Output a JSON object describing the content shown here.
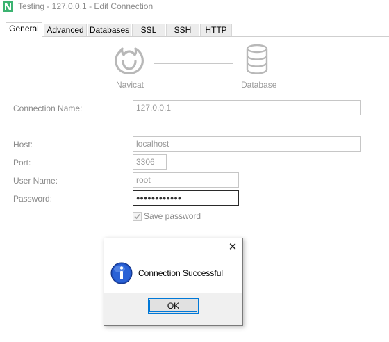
{
  "window": {
    "title": "Testing - 127.0.0.1 - Edit Connection",
    "app_icon": "navicat-app-icon",
    "accent_color": "#3cb371"
  },
  "tabs": [
    {
      "label": "General",
      "active": true
    },
    {
      "label": "Advanced",
      "active": false
    },
    {
      "label": "Databases",
      "active": false
    },
    {
      "label": "SSL",
      "active": false
    },
    {
      "label": "SSH",
      "active": false
    },
    {
      "label": "HTTP",
      "active": false
    }
  ],
  "diagram": {
    "left_icon": "navicat-logo-icon",
    "left_label": "Navicat",
    "right_icon": "database-icon",
    "right_label": "Database"
  },
  "form": {
    "connection_name_label": "Connection Name:",
    "connection_name_value": "127.0.0.1",
    "host_label": "Host:",
    "host_value": "localhost",
    "port_label": "Port:",
    "port_value": "3306",
    "username_label": "User Name:",
    "username_value": "root",
    "password_label": "Password:",
    "password_value": "●●●●●●●●●●●●",
    "save_password_label": "Save password",
    "save_password_checked": true
  },
  "dialog": {
    "message": "Connection Successful",
    "ok_label": "OK",
    "icon": "info-icon",
    "close_icon": "close-icon",
    "close_glyph": "✕"
  }
}
